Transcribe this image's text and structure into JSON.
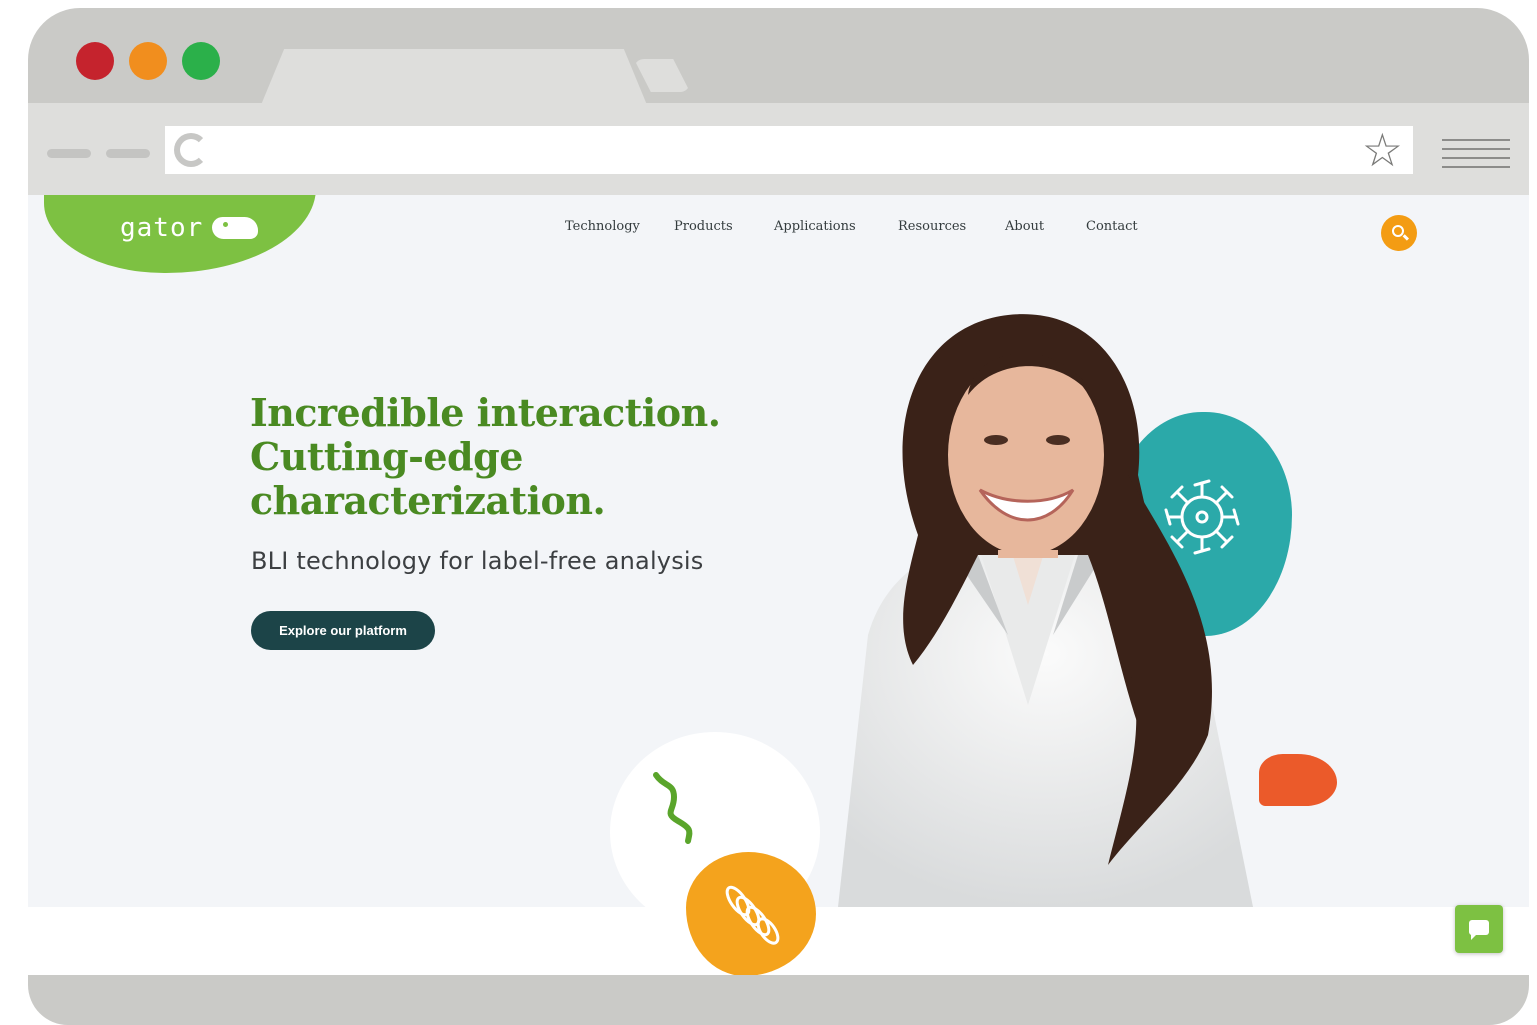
{
  "browser": {
    "window_controls": [
      "close",
      "minimize",
      "maximize"
    ],
    "icons": {
      "reload": "reload-icon",
      "bookmark": "star-icon",
      "menu": "hamburger-menu-icon"
    }
  },
  "site": {
    "logo_text": "gator",
    "brand_colors": {
      "green": "#7dc142",
      "headline_green": "#4a8a22",
      "orange": "#f39c13",
      "teal": "#2ba9a9",
      "dark_teal": "#1c4448",
      "red_orange": "#eb5a2a"
    },
    "nav": {
      "items": [
        {
          "label": "Technology"
        },
        {
          "label": "Products"
        },
        {
          "label": "Applications"
        },
        {
          "label": "Resources"
        },
        {
          "label": "About"
        },
        {
          "label": "Contact"
        }
      ]
    },
    "hero": {
      "headline_line1": "Incredible interaction.",
      "headline_line2": "Cutting-edge",
      "headline_line3": "characterization.",
      "subheadline": "BLI technology for label-free analysis",
      "cta_label": "Explore our platform"
    },
    "icons": {
      "search": "search-icon",
      "chat": "chat-icon",
      "virus": "virus-icon",
      "coil": "coil-icon"
    }
  }
}
